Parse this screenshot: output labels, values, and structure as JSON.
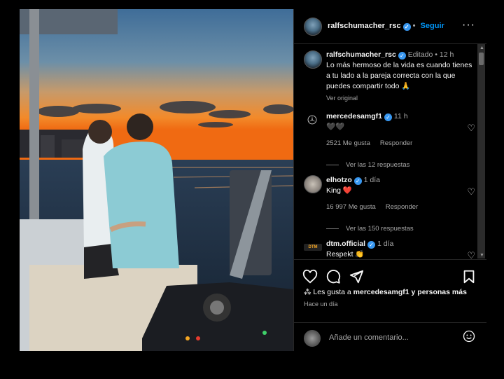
{
  "post": {
    "author": "ralfschumacher_rsc",
    "follow_label": "Seguir",
    "more_label": "···",
    "caption": {
      "author": "ralfschumacher_rsc",
      "edited": "Editado",
      "time": "12 h",
      "text": "Lo más hermoso de la vida es cuando tienes a tu lado a la pareja correcta con la que puedes compartir todo 🙏",
      "see_original": "Ver original"
    }
  },
  "comments": [
    {
      "user": "mercedesamgf1",
      "time": "11 h",
      "text": "🖤🖤",
      "likes": "2521 Me gusta",
      "reply": "Responder",
      "view_replies": "Ver las 12 respuestas"
    },
    {
      "user": "elhotzo",
      "time": "1 día",
      "text": "King ❤️",
      "likes": "16 997 Me gusta",
      "reply": "Responder",
      "view_replies": "Ver las 150 respuestas"
    },
    {
      "user": "dtm.official",
      "time": "1 día",
      "text": "Respekt 👏"
    }
  ],
  "logos": {
    "mercedes": "mercedes-star",
    "dtm": "DTM"
  },
  "footer": {
    "likes_prefix": "Les gusta a",
    "likes_user": "mercedesamgf1",
    "likes_suffix": "y personas más",
    "time": "Hace un día",
    "comment_placeholder": "Añade un comentario..."
  },
  "icons": [
    "heart-icon",
    "comment-icon",
    "share-icon",
    "save-icon",
    "emoji-icon",
    "more-icon",
    "verified-icon"
  ],
  "colors": {
    "accent": "#0095f6",
    "verified": "#3897f0",
    "background": "#000000"
  }
}
